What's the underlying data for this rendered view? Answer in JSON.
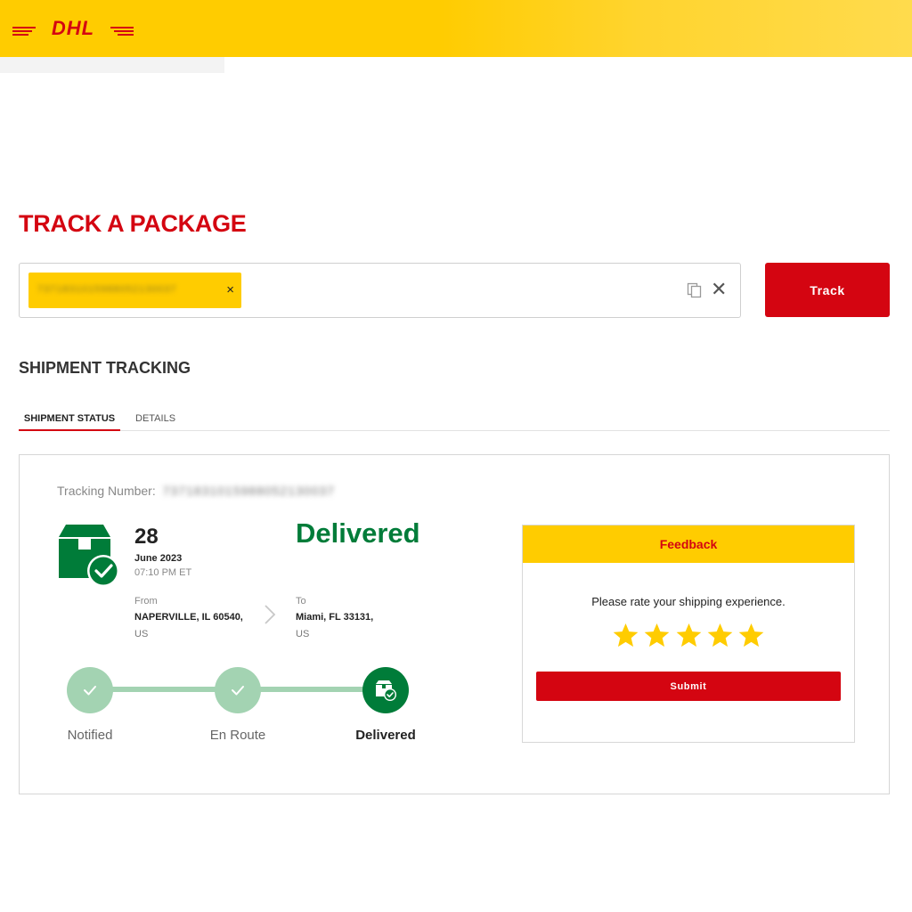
{
  "header": {
    "brand": "DHL",
    "accent": "#ffcc00",
    "brand_red": "#d40511"
  },
  "search": {
    "title": "TRACK A PACKAGE",
    "chip_value": "7371831015988052130037",
    "chip_remove": "×",
    "copy_icon": "copy-icon",
    "clear": "✕",
    "track_label": "Track"
  },
  "shipment": {
    "title": "SHIPMENT TRACKING",
    "tabs": [
      {
        "label": "SHIPMENT STATUS",
        "active": true
      },
      {
        "label": "DETAILS",
        "active": false
      }
    ],
    "tracking_label": "Tracking Number:",
    "tracking_value": "7371831015988052130037",
    "date_day": "28",
    "date_month": "June 2023",
    "date_time": "07:10 PM ET",
    "status": "Delivered",
    "status_color": "#007c39",
    "from": {
      "label": "From",
      "city": "NAPERVILLE, IL 60540,",
      "country": "US"
    },
    "to": {
      "label": "To",
      "city": "Miami, FL 33131,",
      "country": "US"
    },
    "steps": [
      {
        "label": "Notified",
        "state": "done"
      },
      {
        "label": "En Route",
        "state": "done"
      },
      {
        "label": "Delivered",
        "state": "current"
      }
    ]
  },
  "feedback": {
    "title": "Feedback",
    "prompt": "Please rate your shipping experience.",
    "rating_max": 5,
    "submit_label": "Submit"
  }
}
